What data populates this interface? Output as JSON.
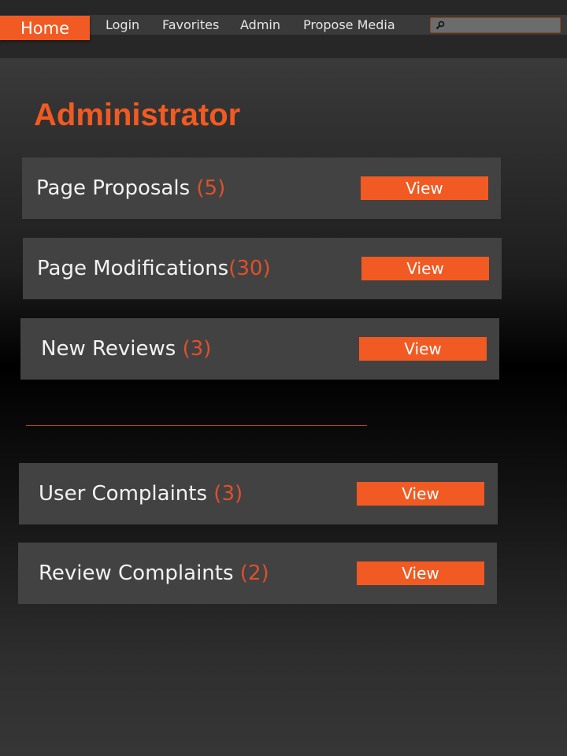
{
  "nav": {
    "home_label": "Home",
    "links": [
      "Login",
      "Favorites",
      "Admin",
      "Propose Media"
    ],
    "search": {
      "value": "",
      "placeholder": ""
    }
  },
  "page_title": "Administrator",
  "sections": [
    {
      "label": "Page Proposals",
      "count": "(5)",
      "button": "View"
    },
    {
      "label": "Page Modifications",
      "count": "(30)",
      "button": "View"
    },
    {
      "label": "New Reviews",
      "count": "(3)",
      "button": "View"
    },
    {
      "label": "User Complaints",
      "count": "(3)",
      "button": "View"
    },
    {
      "label": "Review Complaints",
      "count": "(2)",
      "button": "View"
    }
  ],
  "colors": {
    "accent": "#f15a22",
    "count": "#e0502a",
    "card_bg": "#424242"
  }
}
